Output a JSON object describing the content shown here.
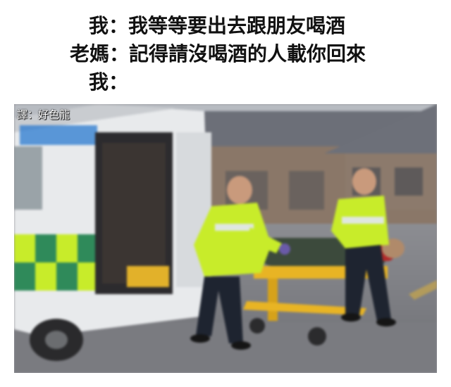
{
  "dialogue": {
    "lines": [
      {
        "speaker": "我",
        "text": "：我等等要出去跟朋友喝酒"
      },
      {
        "speaker": "老媽",
        "text": "：記得請沒喝酒的人載你回來"
      },
      {
        "speaker": "我",
        "text": "："
      }
    ]
  },
  "photo": {
    "credit": "譯：好色龍",
    "subject": "paramedics wheeling a patient on a stretcher into an ambulance",
    "colors": {
      "hi_vis": "#c8ec2a",
      "ambulance_green": "#2f8a5a",
      "stretcher": "#e8b424"
    }
  }
}
